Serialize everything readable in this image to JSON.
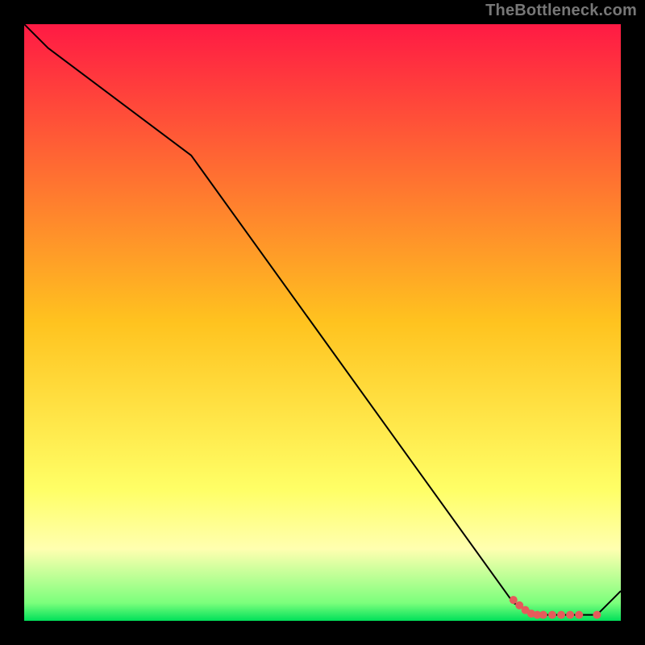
{
  "watermark": "TheBottleneck.com",
  "chart_data": {
    "type": "line",
    "title": "",
    "xlabel": "",
    "ylabel": "",
    "xlim": [
      0,
      100
    ],
    "ylim": [
      0,
      100
    ],
    "grid": false,
    "legend": false,
    "background_gradient": {
      "stops": [
        {
          "offset": 0.0,
          "color": "#ff1a44"
        },
        {
          "offset": 0.5,
          "color": "#ffc31f"
        },
        {
          "offset": 0.78,
          "color": "#ffff66"
        },
        {
          "offset": 0.88,
          "color": "#ffffb0"
        },
        {
          "offset": 0.97,
          "color": "#7cff7c"
        },
        {
          "offset": 1.0,
          "color": "#00e05a"
        }
      ]
    },
    "series": [
      {
        "name": "bottleneck-curve",
        "color": "#000000",
        "stroke_width": 2,
        "x": [
          0,
          4,
          28,
          82,
          86,
          92,
          96,
          100
        ],
        "y": [
          100,
          96,
          78,
          3,
          1,
          1,
          1,
          5
        ]
      }
    ],
    "markers": {
      "color": "#e55b5b",
      "points": [
        {
          "x": 82.0,
          "y": 3.5
        },
        {
          "x": 83.0,
          "y": 2.6
        },
        {
          "x": 84.0,
          "y": 1.8
        },
        {
          "x": 85.0,
          "y": 1.2
        },
        {
          "x": 86.0,
          "y": 1.0
        },
        {
          "x": 87.0,
          "y": 1.0
        },
        {
          "x": 88.5,
          "y": 1.0
        },
        {
          "x": 90.0,
          "y": 1.0
        },
        {
          "x": 91.5,
          "y": 1.0
        },
        {
          "x": 93.0,
          "y": 1.0
        },
        {
          "x": 96.0,
          "y": 1.0
        }
      ]
    }
  }
}
